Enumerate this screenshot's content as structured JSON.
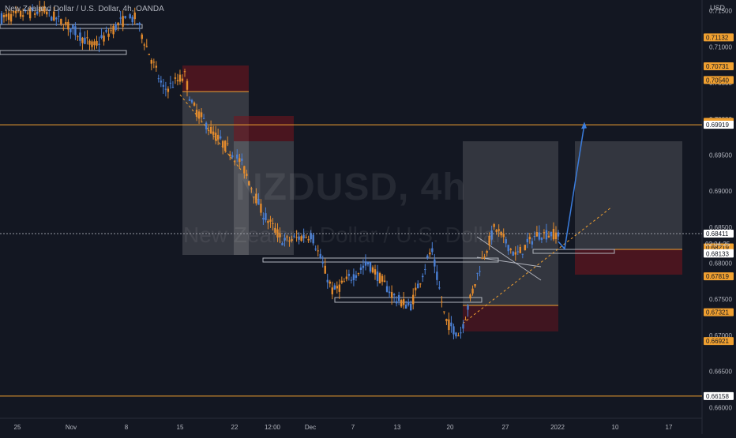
{
  "header": {
    "title": "New Zealand Dollar / U.S. Dollar, 4h, OANDA",
    "currency": "USD"
  },
  "watermark": {
    "symbol": "NZDUSD, 4h",
    "name": "New Zealand Dollar / U.S. Dollar"
  },
  "price_axis": {
    "ticks": [
      "0.71500",
      "0.71000",
      "0.70500",
      "0.70000",
      "0.69500",
      "0.69000",
      "0.68500",
      "0.68000",
      "0.67500",
      "0.67000",
      "0.66500",
      "0.66000"
    ],
    "badges": [
      {
        "text": "0.71132",
        "value": 0.71132,
        "color": "#f0a030"
      },
      {
        "text": "0.70731",
        "value": 0.70731,
        "color": "#f0a030"
      },
      {
        "text": "0.70540",
        "value": 0.7054,
        "color": "#f0a030"
      },
      {
        "text": "0.69961",
        "value": 0.69961,
        "color": "#f0a030"
      },
      {
        "text": "0.69940",
        "value": 0.6994,
        "color": "#f0a030"
      },
      {
        "text": "0.69921",
        "value": 0.69921,
        "color": "#ffffff"
      },
      {
        "text": "0.69919",
        "value": 0.69919,
        "color": "#ffffff"
      },
      {
        "text": "0.68411",
        "value": 0.68411,
        "color": "#ffffff"
      },
      {
        "text": "0.68219",
        "value": 0.68219,
        "color": "#f0a030"
      },
      {
        "text": "0.68140",
        "value": 0.6814,
        "color": "#ffffff"
      },
      {
        "text": "0.68133",
        "value": 0.68133,
        "color": "#ffffff"
      },
      {
        "text": "0.67819",
        "value": 0.67819,
        "color": "#f0a030"
      },
      {
        "text": "0.67321",
        "value": 0.67321,
        "color": "#f0a030"
      },
      {
        "text": "0.66921",
        "value": 0.66921,
        "color": "#f0a030"
      },
      {
        "text": "0.66158",
        "value": 0.66158,
        "color": "#ffffff"
      }
    ],
    "countdown": "02:04:25"
  },
  "time_axis": {
    "ticks": [
      "25",
      "Nov",
      "8",
      "15",
      "22",
      "12:00",
      "Dec",
      "7",
      "13",
      "20",
      "27",
      "2022",
      "10",
      "17"
    ]
  },
  "chart_data": {
    "type": "candlestick",
    "title": "New Zealand Dollar / U.S. Dollar, 4h, OANDA",
    "symbol": "NZDUSD",
    "interval": "4h",
    "ylim": [
      0.6585,
      0.7165
    ],
    "yticks": [
      0.715,
      0.71,
      0.705,
      0.7,
      0.695,
      0.69,
      0.685,
      0.68,
      0.675,
      0.67,
      0.665,
      0.66
    ],
    "last_price": 0.68411,
    "horizontal_levels": [
      0.69919,
      0.68411,
      0.66158
    ],
    "path_approx": [
      {
        "t": 0.0,
        "p": 0.714
      },
      {
        "t": 0.06,
        "p": 0.715
      },
      {
        "t": 0.1,
        "p": 0.7125
      },
      {
        "t": 0.13,
        "p": 0.71
      },
      {
        "t": 0.17,
        "p": 0.7135
      },
      {
        "t": 0.19,
        "p": 0.714
      },
      {
        "t": 0.23,
        "p": 0.704
      },
      {
        "t": 0.26,
        "p": 0.706
      },
      {
        "t": 0.27,
        "p": 0.702
      },
      {
        "t": 0.3,
        "p": 0.698
      },
      {
        "t": 0.34,
        "p": 0.694
      },
      {
        "t": 0.37,
        "p": 0.687
      },
      {
        "t": 0.4,
        "p": 0.683
      },
      {
        "t": 0.44,
        "p": 0.684
      },
      {
        "t": 0.47,
        "p": 0.676
      },
      {
        "t": 0.52,
        "p": 0.68
      },
      {
        "t": 0.56,
        "p": 0.675
      },
      {
        "t": 0.58,
        "p": 0.674
      },
      {
        "t": 0.61,
        "p": 0.682
      },
      {
        "t": 0.63,
        "p": 0.672
      },
      {
        "t": 0.65,
        "p": 0.67
      },
      {
        "t": 0.68,
        "p": 0.68
      },
      {
        "t": 0.7,
        "p": 0.685
      },
      {
        "t": 0.73,
        "p": 0.681
      },
      {
        "t": 0.76,
        "p": 0.684
      },
      {
        "t": 0.79,
        "p": 0.6841
      }
    ],
    "projection": {
      "from": 0.6825,
      "to": 0.6995
    }
  }
}
